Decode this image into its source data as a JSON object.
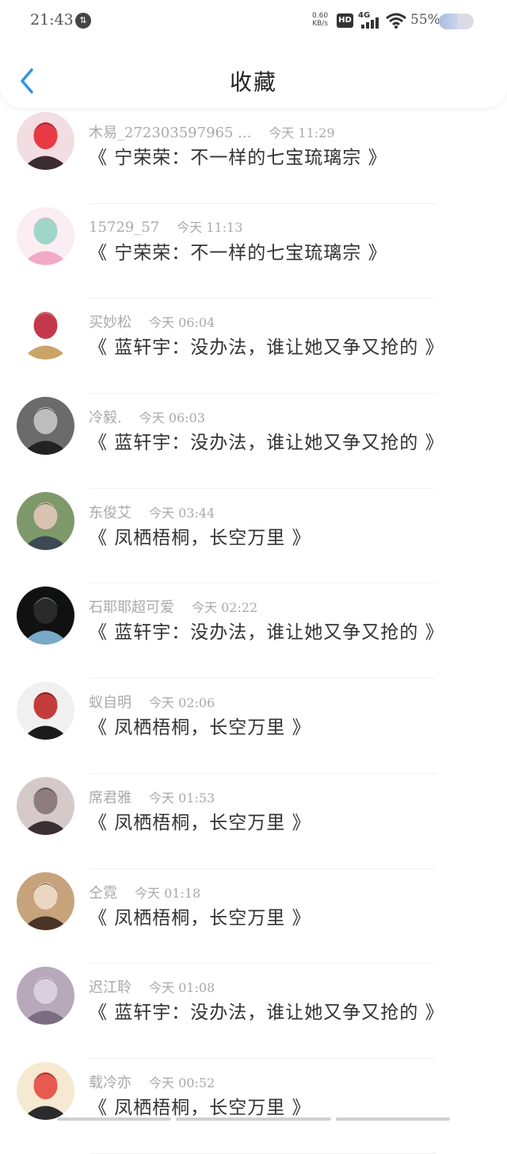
{
  "status_bar": {
    "time": "21:43",
    "net_speed_value": "0.60",
    "net_speed_unit": "KB/s",
    "hd_label": "HD",
    "network_label": "4G",
    "battery_percent": "55%",
    "battery_level": 0.55
  },
  "header": {
    "title": "收藏",
    "back_icon": "chevron-left-icon"
  },
  "favorites": [
    {
      "user": "木易_272303597965 ...",
      "time": "今天 11:29",
      "title": "《 宁荣荣：不一样的七宝琉璃宗 》",
      "avatar_colors": [
        "#f2dde2",
        "#3a2c30",
        "#e73a45"
      ]
    },
    {
      "user": "15729_57",
      "time": "今天 11:13",
      "title": "《 宁荣荣：不一样的七宝琉璃宗 》",
      "avatar_colors": [
        "#fbeef3",
        "#f1a9c4",
        "#9fd6c9"
      ]
    },
    {
      "user": "买妙松",
      "time": "今天 06:04",
      "title": "《 蓝轩宇：没办法，谁让她又争又抢的 》",
      "avatar_colors": [
        "#ffffff",
        "#c9a467",
        "#c23a4a"
      ]
    },
    {
      "user": "冷毅.",
      "time": "今天 06:03",
      "title": "《 蓝轩宇：没办法，谁让她又争又抢的 》",
      "avatar_colors": [
        "#6b6b6b",
        "#222222",
        "#bdbdbd"
      ]
    },
    {
      "user": "东俊艾",
      "time": "今天 03:44",
      "title": "《 凤栖梧桐，长空万里 》",
      "avatar_colors": [
        "#7f9a6a",
        "#3d4a55",
        "#d9c3b0"
      ]
    },
    {
      "user": "石耶耶超可爱",
      "time": "今天 02:22",
      "title": "《 蓝轩宇：没办法，谁让她又争又抢的 》",
      "avatar_colors": [
        "#111111",
        "#78a9c8",
        "#2a2a2a"
      ]
    },
    {
      "user": "蚁自明",
      "time": "今天 02:06",
      "title": "《 凤栖梧桐，长空万里 》",
      "avatar_colors": [
        "#f0f0f0",
        "#1b1b1b",
        "#c33b3b"
      ]
    },
    {
      "user": "席君雅",
      "time": "今天 01:53",
      "title": "《 凤栖梧桐，长空万里 》",
      "avatar_colors": [
        "#d6c9c9",
        "#3a2f33",
        "#8e7c7f"
      ]
    },
    {
      "user": "仝霓",
      "time": "今天 01:18",
      "title": "《 凤栖梧桐，长空万里 》",
      "avatar_colors": [
        "#c7a37c",
        "#4a3428",
        "#e9d7c2"
      ]
    },
    {
      "user": "迟江聆",
      "time": "今天 01:08",
      "title": "《 蓝轩宇：没办法，谁让她又争又抢的 》",
      "avatar_colors": [
        "#b8a8bb",
        "#7c6d83",
        "#d9cfdd"
      ]
    },
    {
      "user": "载冷亦",
      "time": "今天 00:52",
      "title": "《 凤栖梧桐，长空万里 》",
      "avatar_colors": [
        "#f5e9d2",
        "#2b2b2b",
        "#e85a4f"
      ]
    }
  ],
  "colors": {
    "accent": "#2f95e0",
    "meta_text": "#a9a9a9",
    "title_text": "#333333"
  }
}
